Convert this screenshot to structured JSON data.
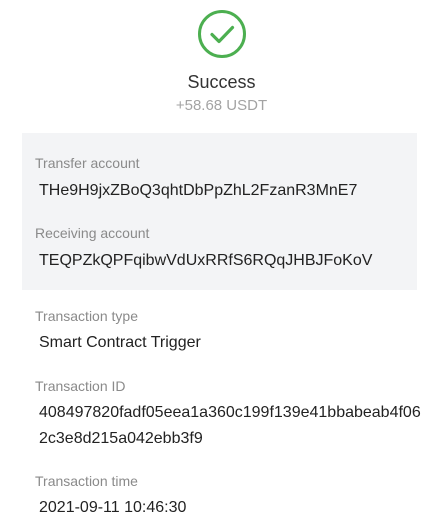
{
  "status": {
    "icon": "check-circle-icon",
    "title": "Success",
    "amount": "+58.68 USDT",
    "accent_color": "#4caf50"
  },
  "accounts": {
    "transfer_label": "Transfer account",
    "transfer_value": "THe9H9jxZBoQ3qhtDbPpZhL2FzanR3MnE7",
    "receiving_label": "Receiving account",
    "receiving_value": "TEQPZkQPFqibwVdUxRRfS6RQqJHBJFoKoV"
  },
  "details": {
    "type_label": "Transaction type",
    "type_value": "Smart Contract Trigger",
    "id_label": "Transaction ID",
    "id_value": "408497820fadf05eea1a360c199f139e41bbabeab4f062c3e8d215a042ebb3f9",
    "time_label": "Transaction time",
    "time_value": "2021-09-11 10:46:30"
  }
}
